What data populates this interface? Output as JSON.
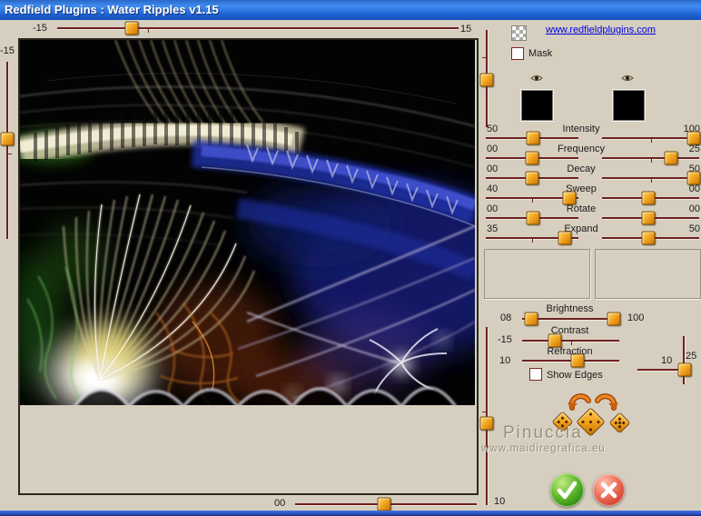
{
  "window": {
    "title": "Redfield Plugins : Water Ripples v1.15"
  },
  "header": {
    "link_label": "www.redfieldplugins.com",
    "mask_label": "Mask"
  },
  "frame_sliders": {
    "top": {
      "left_label": "-15",
      "right_label": "15",
      "frac": 0.185
    },
    "left": {
      "top_label": "-15",
      "frac": 0.436
    },
    "right_upper": {
      "frac": 0.51
    },
    "right_lower": {
      "frac": 0.54
    },
    "bottom": {
      "left_label": "00",
      "right_label": "10",
      "frac": 0.49
    }
  },
  "params": [
    {
      "name": "Intensity",
      "left_value": "50",
      "right_value": "100",
      "left_frac": 0.51,
      "right_frac": 0.94
    },
    {
      "name": "Frequency",
      "left_value": "00",
      "right_value": "25",
      "left_frac": 0.5,
      "right_frac": 0.71
    },
    {
      "name": "Decay",
      "left_value": "00",
      "right_value": "50",
      "left_frac": 0.5,
      "right_frac": 0.94
    },
    {
      "name": "Sweep",
      "left_value": "40",
      "right_value": "00",
      "left_frac": 0.9,
      "right_frac": 0.48
    },
    {
      "name": "Rotate",
      "left_value": "00",
      "right_value": "00",
      "left_frac": 0.51,
      "right_frac": 0.48
    },
    {
      "name": "Expand",
      "left_value": "35",
      "right_value": "50",
      "left_frac": 0.85,
      "right_frac": 0.48
    }
  ],
  "adjust": {
    "brightness": {
      "name": "Brightness",
      "left_value": "08",
      "right_value": "100",
      "low_frac": 0.09,
      "high_frac": 0.94
    },
    "contrast": {
      "name": "Contrast",
      "left_value": "-15",
      "frac": 0.34
    },
    "refraction": {
      "name": "Refraction",
      "left_value": "10",
      "frac": 0.57
    },
    "show_edges_label": "Show Edges"
  },
  "corner": {
    "h_value": "10",
    "v_value": "25",
    "h_frac": 1.0
  },
  "watermark": {
    "name": "Pinuccia",
    "site": "www.maidiregrafica.eu"
  },
  "colors": {
    "background": "#d6cfc0",
    "titlebar_blue": "#1f60d0",
    "track_maroon": "#6e2222",
    "handle_orange": "#f0a31e",
    "link_blue": "#0000dd",
    "ok_green": "#3f9c1c",
    "cancel_red": "#d64737",
    "thumb_yellow": "#e6e000"
  }
}
